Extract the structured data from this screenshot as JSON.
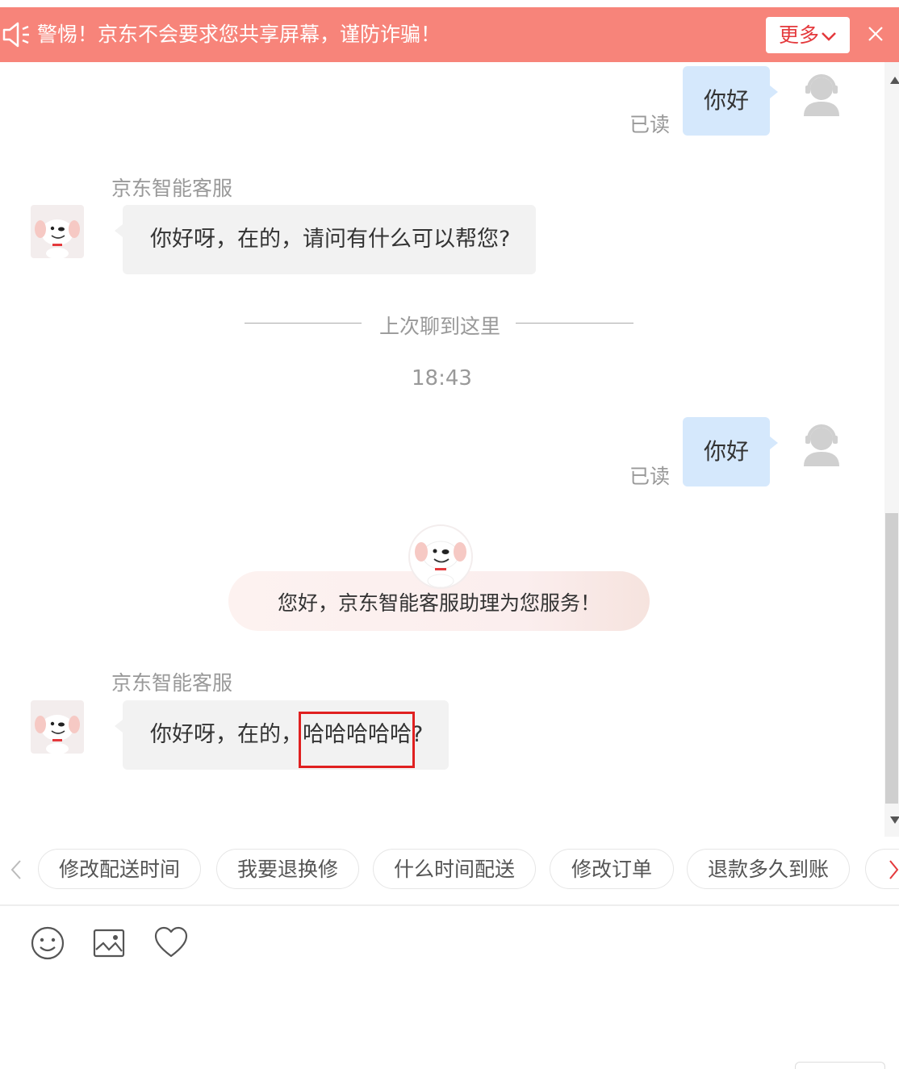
{
  "banner": {
    "text": "警惕！京东不会要求您共享屏幕，谨防诈骗！",
    "more_label": "更多",
    "icons": [
      "speaker-icon",
      "chevron-down-icon",
      "close-icon"
    ]
  },
  "messages": {
    "user_1": {
      "text": "你好",
      "status": "已读"
    },
    "bot_1": {
      "name": "京东智能客服",
      "text": "你好呀，在的，请问有什么可以帮您?"
    },
    "divider": {
      "text": "上次聊到这里"
    },
    "time": "18:43",
    "user_2": {
      "text": "你好",
      "status": "已读"
    },
    "welcome": {
      "text": "您好，京东智能客服助理为您服务！"
    },
    "bot_2": {
      "name": "京东智能客服",
      "text_before": "你好呀，在的，",
      "text_highlight": "哈哈哈哈哈",
      "text_after": "?"
    }
  },
  "quick_replies": [
    "修改配送时间",
    "我要退换修",
    "什么时间配送",
    "修改订单",
    "退款多久到账"
  ],
  "toolbar": {
    "icons": [
      "emoji-icon",
      "image-icon",
      "heart-icon"
    ]
  },
  "colors": {
    "banner": "#f7847a",
    "accent": "#e4393c",
    "user_bubble": "#d5e8fc",
    "bot_bubble": "#f2f2f2",
    "highlight": "#e02020"
  }
}
